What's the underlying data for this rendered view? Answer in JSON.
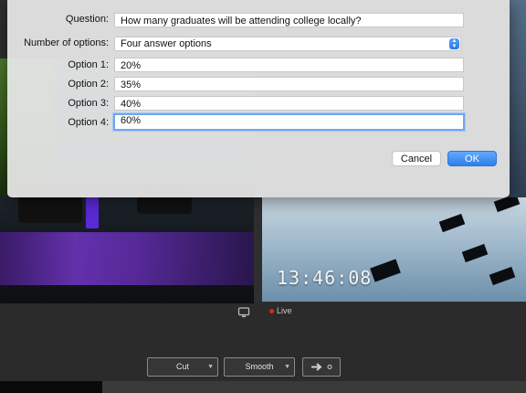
{
  "dialog": {
    "question_label": "Question:",
    "question_value": "How many graduates will be attending college locally?",
    "num_options_label": "Number of options:",
    "num_options_value": "Four answer options",
    "options": [
      {
        "label": "Option 1:",
        "value": "20%"
      },
      {
        "label": "Option 2:",
        "value": "35%"
      },
      {
        "label": "Option 3:",
        "value": "40%"
      },
      {
        "label": "Option 4:",
        "value": "60%"
      }
    ],
    "cancel_label": "Cancel",
    "ok_label": "OK"
  },
  "preview": {
    "clock": "13:46:08",
    "live_label": "Live"
  },
  "controls": {
    "cut_label": "Cut",
    "smooth_label": "Smooth",
    "go_icon": "arrow-right-icon"
  },
  "colors": {
    "accent": "#2e7fe9",
    "live_dot": "#e0251b",
    "purple_band": "#6a33b8"
  }
}
